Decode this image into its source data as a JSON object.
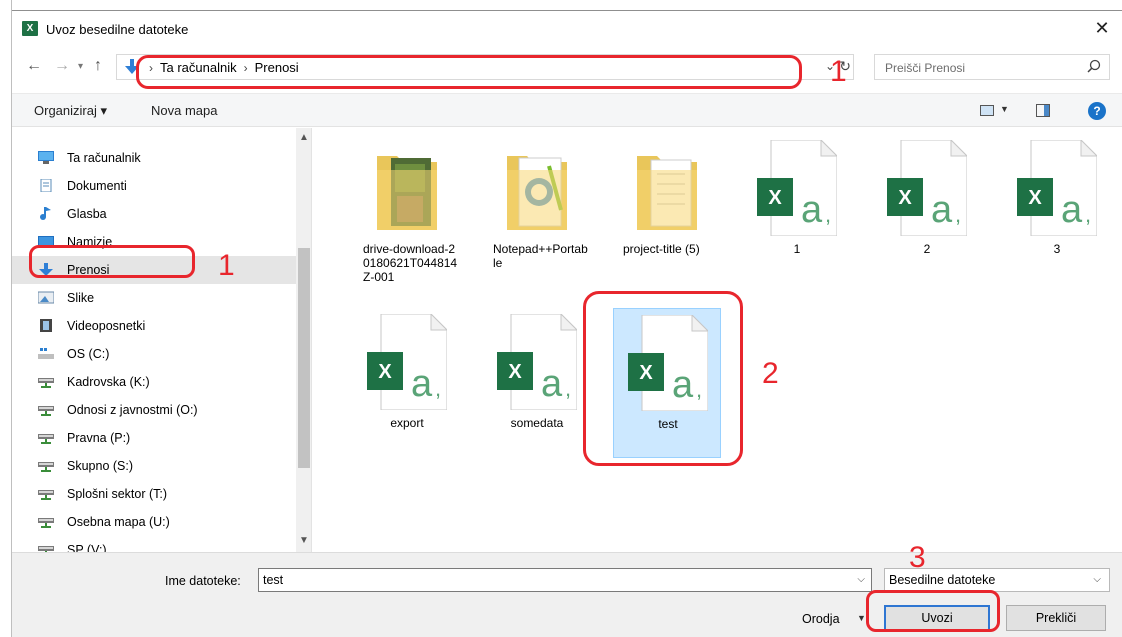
{
  "window": {
    "title": "Uvoz besedilne datoteke",
    "app_icon": "excel-icon",
    "close_glyph": "✕"
  },
  "address": {
    "crumbs": [
      "Ta računalnik",
      "Prenosi"
    ],
    "search_placeholder": "Preišči Prenosi"
  },
  "toolbar": {
    "organize": "Organiziraj ▾",
    "new_folder": "Nova mapa",
    "help": "?"
  },
  "nav": {
    "items": [
      {
        "label": "Ta računalnik",
        "icon": "computer-icon"
      },
      {
        "label": "Dokumenti",
        "icon": "documents-icon"
      },
      {
        "label": "Glasba",
        "icon": "music-icon"
      },
      {
        "label": "Namizje",
        "icon": "desktop-icon"
      },
      {
        "label": "Prenosi",
        "icon": "downloads-icon"
      },
      {
        "label": "Slike",
        "icon": "pictures-icon"
      },
      {
        "label": "Videoposnetki",
        "icon": "videos-icon"
      },
      {
        "label": "OS (C:)",
        "icon": "drive-icon"
      },
      {
        "label": "Kadrovska (K:)",
        "icon": "network-drive-icon"
      },
      {
        "label": "Odnosi z javnostmi (O:)",
        "icon": "network-drive-icon"
      },
      {
        "label": "Pravna (P:)",
        "icon": "network-drive-icon"
      },
      {
        "label": "Skupno (S:)",
        "icon": "network-drive-icon"
      },
      {
        "label": "Splošni sektor (T:)",
        "icon": "network-drive-icon"
      },
      {
        "label": "Osebna mapa (U:)",
        "icon": "network-drive-icon"
      },
      {
        "label": "SP (V:)",
        "icon": "network-drive-icon"
      }
    ]
  },
  "files": [
    {
      "name": "drive-download-20180621T044814Z-001",
      "kind": "folder-photos"
    },
    {
      "name": "Notepad++Portable",
      "kind": "folder-notepad"
    },
    {
      "name": "project-title (5)",
      "kind": "folder-docs"
    },
    {
      "name": "1",
      "kind": "excel-csv"
    },
    {
      "name": "2",
      "kind": "excel-csv"
    },
    {
      "name": "3",
      "kind": "excel-csv"
    },
    {
      "name": "export",
      "kind": "excel-csv"
    },
    {
      "name": "somedata",
      "kind": "excel-csv"
    },
    {
      "name": "test",
      "kind": "excel-csv"
    }
  ],
  "bottom": {
    "filename_label": "Ime datoteke:",
    "filename_value": "test",
    "file_type": "Besedilne datoteke",
    "tools": "Orodja",
    "import": "Uvozi",
    "cancel": "Prekliči"
  },
  "annotations": {
    "addr": "1",
    "nav": "1",
    "file": "2",
    "button": "3",
    "color": "#e8262d"
  },
  "colors": {
    "excel_green": "#1e7145",
    "selection": "#cce8ff",
    "accent": "#2f76d2"
  }
}
